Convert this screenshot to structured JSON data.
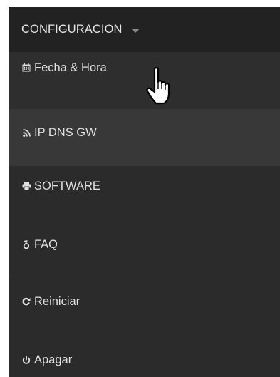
{
  "menu": {
    "title": "CONFIGURACION",
    "items": [
      {
        "label": "Fecha & Hora",
        "icon": "calendar-icon"
      },
      {
        "label": "IP DNS GW",
        "icon": "rss-icon"
      },
      {
        "label": "SOFTWARE",
        "icon": "print-icon"
      },
      {
        "label": "FAQ",
        "icon": "gender-icon"
      },
      {
        "label": "Reiniciar",
        "icon": "refresh-icon"
      },
      {
        "label": "Apagar",
        "icon": "power-icon"
      }
    ]
  },
  "colors": {
    "header_bg": "#222222",
    "menu_bg": "#2b2b2b",
    "hover_bg": "#383838",
    "text": "#e0e0e0"
  }
}
